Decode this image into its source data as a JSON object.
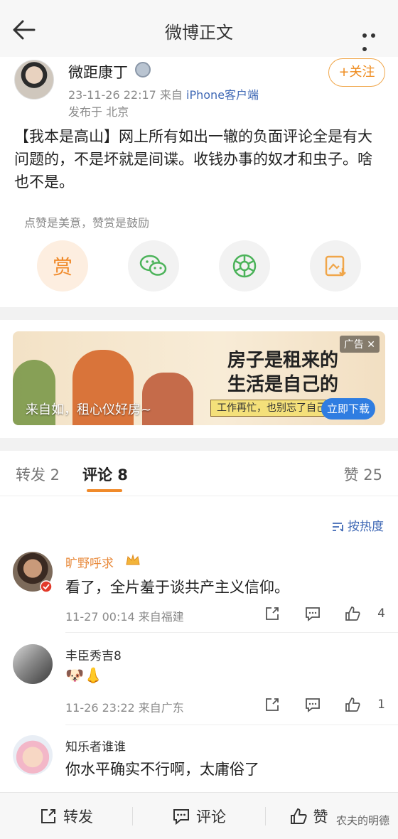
{
  "topbar": {
    "title": "微博正文"
  },
  "post": {
    "username": "微距康丁",
    "timestamp": "23-11-26 22:17",
    "from_prefix": "来自",
    "source": "iPhone客户端",
    "location": "发布于 北京",
    "follow_label": "+关注",
    "content": "【我本是高山】网上所有如出一辙的负面评论全是有大问题的，不是坏就是间谍。收钱办事的奴才和虫子。啥也不是。",
    "reward_hint": "点赞是美意，赞赏是鼓励",
    "reward_label": "赏"
  },
  "ad": {
    "tag": "广告",
    "headline_line1": "房子是租来的",
    "headline_line2": "生活是自己的",
    "sub": "工作再忙，也别忘了自己",
    "cta": "立即下载",
    "slogan": "来自如，租心仪好房~"
  },
  "tabs": {
    "repost": "转发 2",
    "comment": "评论 8",
    "like": "赞 25"
  },
  "sort_label": "按热度",
  "comments": [
    {
      "name": "旷野呼求",
      "text": "看了，全片羞于谈共产主义信仰。",
      "meta": "11-27 00:14 来自福建",
      "likes": "4"
    },
    {
      "name": "丰臣秀吉8",
      "text": "🐶👃",
      "meta": "11-26 23:22 来自广东",
      "likes": "1"
    },
    {
      "name": "知乐者谁谁",
      "text": "你水平确实不行啊，太庸俗了",
      "meta": "",
      "likes": ""
    }
  ],
  "bottombar": {
    "repost": "转发",
    "comment": "评论",
    "like": "赞"
  },
  "watermark": "农夫的明德",
  "colors": {
    "accent": "#f08a2a",
    "link": "#3f68b5",
    "name": "#e8893a"
  }
}
